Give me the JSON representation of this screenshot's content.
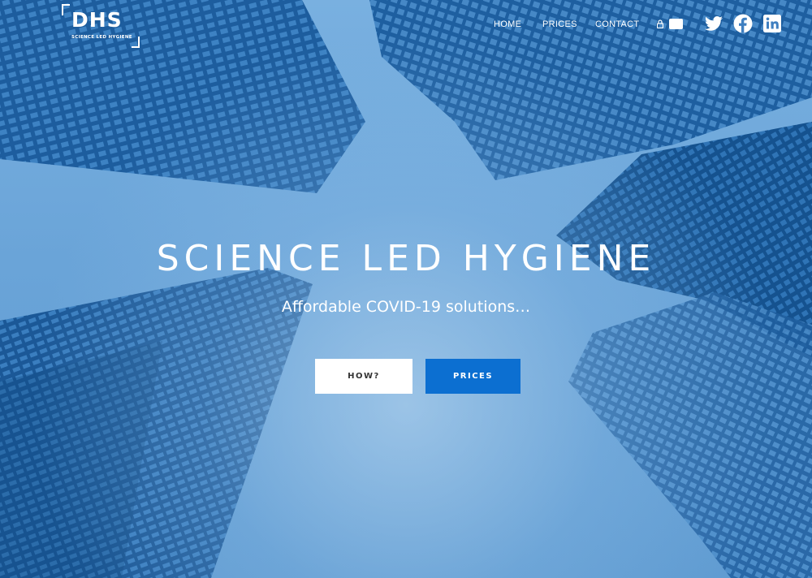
{
  "brand": {
    "logo_text": "DHS",
    "tagline": "SCIENCE LED HYGIENE"
  },
  "nav": {
    "items": [
      {
        "label": "HOME"
      },
      {
        "label": "PRICES"
      },
      {
        "label": "CONTACT"
      }
    ]
  },
  "social": [
    "twitter-icon",
    "facebook-icon",
    "linkedin-icon"
  ],
  "hero": {
    "headline": "SCIENCE LED HYGIENE",
    "subtitle": "Affordable COVID-19 solutions…",
    "buttons": {
      "how_label": "HOW?",
      "prices_label": "PRICES"
    }
  },
  "colors": {
    "accent": "#0c6fd1",
    "sky": "#79b0e0",
    "building_dark": "#1c5c9c"
  }
}
